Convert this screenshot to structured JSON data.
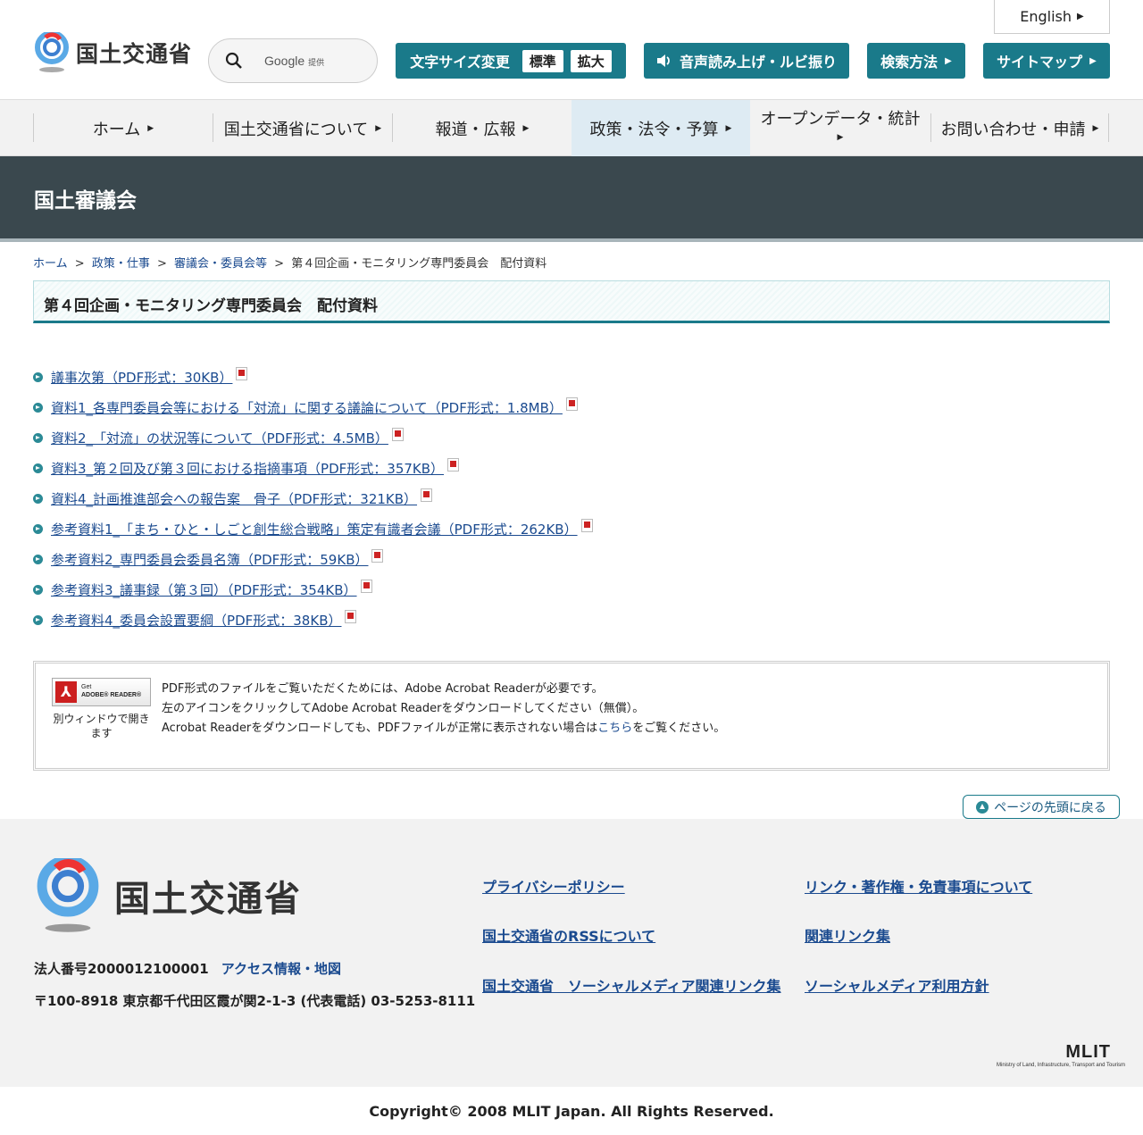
{
  "header": {
    "english_label": "English",
    "logo_text": "国土交通省",
    "search": {
      "brand": "Google",
      "brand_suffix": "提供"
    },
    "font_size": {
      "label": "文字サイズ変更",
      "standard": "標準",
      "large": "拡大"
    },
    "read_aloud": "音声読み上げ・ルビ振り",
    "search_method": "検索方法",
    "sitemap": "サイトマップ"
  },
  "gnav": {
    "items": [
      {
        "label": "ホーム"
      },
      {
        "label": "国土交通省について"
      },
      {
        "label": "報道・広報"
      },
      {
        "label": "政策・法令・予算"
      },
      {
        "label": "オープンデータ・統計"
      },
      {
        "label": "お問い合わせ・申請"
      }
    ]
  },
  "title_bar": {
    "title": "国土審議会"
  },
  "breadcrumb": {
    "items": [
      "ホーム",
      "政策・仕事",
      "審議会・委員会等"
    ],
    "current": "第４回企画・モニタリング専門委員会　配付資料",
    "separator": ">"
  },
  "page": {
    "heading": "第４回企画・モニタリング専門委員会　配付資料"
  },
  "documents": [
    "議事次第（PDF形式：30KB）",
    "資料1_各専門委員会等における「対流」に関する議論について（PDF形式：1.8MB）",
    "資料2_「対流」の状況等について（PDF形式：4.5MB）",
    "資料3_第２回及び第３回における指摘事項（PDF形式：357KB）",
    "資料4_計画推進部会への報告案　骨子（PDF形式：321KB）",
    "参考資料1_「まち・ひと・しごと創生総合戦略」策定有識者会議（PDF形式：262KB）",
    "参考資料2_専門委員会委員名簿（PDF形式：59KB）",
    "参考資料3_議事録（第３回）（PDF形式：354KB）",
    "参考資料4_委員会設置要綱（PDF形式：38KB）"
  ],
  "adobe": {
    "badge_get": "Get",
    "badge_name": "ADOBE® READER®",
    "caption": "別ウィンドウで開きます",
    "line1": "PDF形式のファイルをご覧いただくためには、Adobe Acrobat Readerが必要です。",
    "line2": "左のアイコンをクリックしてAdobe Acrobat Readerをダウンロードしてください（無償）。",
    "line3_pre": "Acrobat Readerをダウンロードしても、PDFファイルが正常に表示されない場合は",
    "line3_link": "こちら",
    "line3_post": "をご覧ください。"
  },
  "pagetop": "ページの先頭に戻る",
  "footer": {
    "logo_text": "国土交通省",
    "corp_number": "法人番号2000012100001",
    "access_link": "アクセス情報・地図",
    "address": "〒100-8918 東京都千代田区霞が関2-1-3 (代表電話) 03-5253-8111",
    "links_col1": [
      "プライバシーポリシー",
      "国土交通省のRSSについて",
      "国土交通省　ソーシャルメディア関連リンク集"
    ],
    "links_col2": [
      "リンク・著作権・免責事項について",
      "関連リンク集",
      "ソーシャルメディア利用方針"
    ],
    "mlit_logo": "MLIT",
    "mlit_sub": "Ministry of Land, Infrastructure, Transport and Tourism",
    "copyright": "Copyright© 2008 MLIT Japan. All Rights Reserved."
  },
  "colors": {
    "accent": "#1a7a8a",
    "title_bar": "#3a484e",
    "link": "#1a4a8f"
  }
}
